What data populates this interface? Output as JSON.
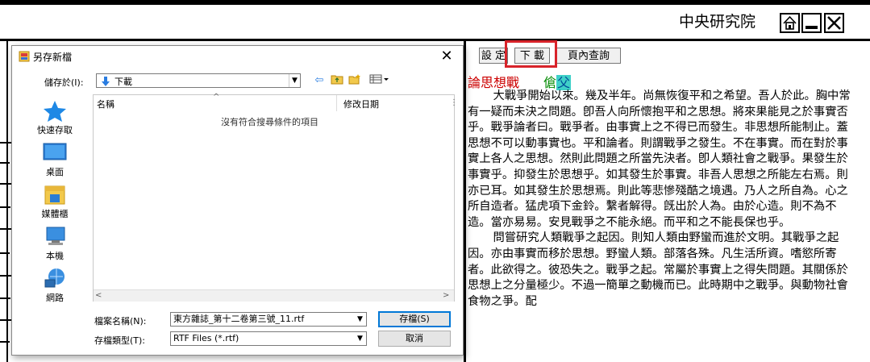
{
  "header": {
    "institution": "中央研究院",
    "window_buttons": [
      "home-icon",
      "minimize-icon",
      "close-icon"
    ]
  },
  "toolbar": {
    "settings_label": "設 定",
    "download_label": "下 載",
    "page_search_label": "頁內查詢"
  },
  "article": {
    "title": "論思想戰",
    "author_prefix": "傖",
    "author_highlight": "父",
    "paragraphs": [
      "大戰爭開始以來。幾及半年。尚無恢復平和之希望。吾人於此。胸中常有一疑而未決之問題。卽吾人向所懷抱平和之思想。將來果能見之於事實否乎。戰爭論者曰。戰爭者。由事實上之不得已而發生。非思想所能制止。蓋思想不可以動事實也。平和論者。則謂戰爭之發生。不在事實。而在對於事實上各人之思想。然則此問題之所當先決者。卽人類社會之戰爭。果發生於事實乎。抑發生於思想乎。如其發生於事實。非吾人思想之所能左右焉。則亦已耳。如其發生於思想焉。則此等悲慘殘酷之境遇。乃人之所自為。心之所自造者。猛虎項下金鈴。繫者解得。旣出於人為。由於心造。則不為不造。當亦易易。安見戰爭之不能永絕。而平和之不能長保也乎。",
      "問嘗研究人類戰爭之起因。則知人類由野蠻而進於文明。其戰爭之起因。亦由事實而移於思想。野蠻人類。部落各殊。凡生活所資。嗜慾所寄者。此欲得之。彼恐失之。戰爭之起。常屬於事實上之得失問題。其關係於思想上之分量極少。不過一簡單之動機而已。此時期中之戰爭。與動物社會食物之爭。配"
    ]
  },
  "dialog": {
    "title": "另存新檔",
    "save_in_label": "儲存於(I):",
    "save_in_value": "下載",
    "toolbar_icons": [
      "back-arrow-icon",
      "up-folder-icon",
      "new-folder-icon",
      "view-menu-icon"
    ],
    "places": [
      {
        "label": "快速存取",
        "icon": "quick-access-star-icon"
      },
      {
        "label": "桌面",
        "icon": "desktop-icon"
      },
      {
        "label": "媒體櫃",
        "icon": "libraries-icon"
      },
      {
        "label": "本機",
        "icon": "this-pc-icon"
      },
      {
        "label": "網路",
        "icon": "network-icon"
      }
    ],
    "columns": {
      "name": "名稱",
      "date": "修改日期"
    },
    "empty_message": "沒有符合搜尋條件的項目",
    "filename_label": "檔案名稱(N):",
    "filename_value": "東方雜誌_第十二卷第三號_11.rtf",
    "filetype_label": "存檔類型(T):",
    "filetype_value": "RTF Files (*.rtf)",
    "save_button": "存檔(S)",
    "cancel_button": "取消"
  }
}
